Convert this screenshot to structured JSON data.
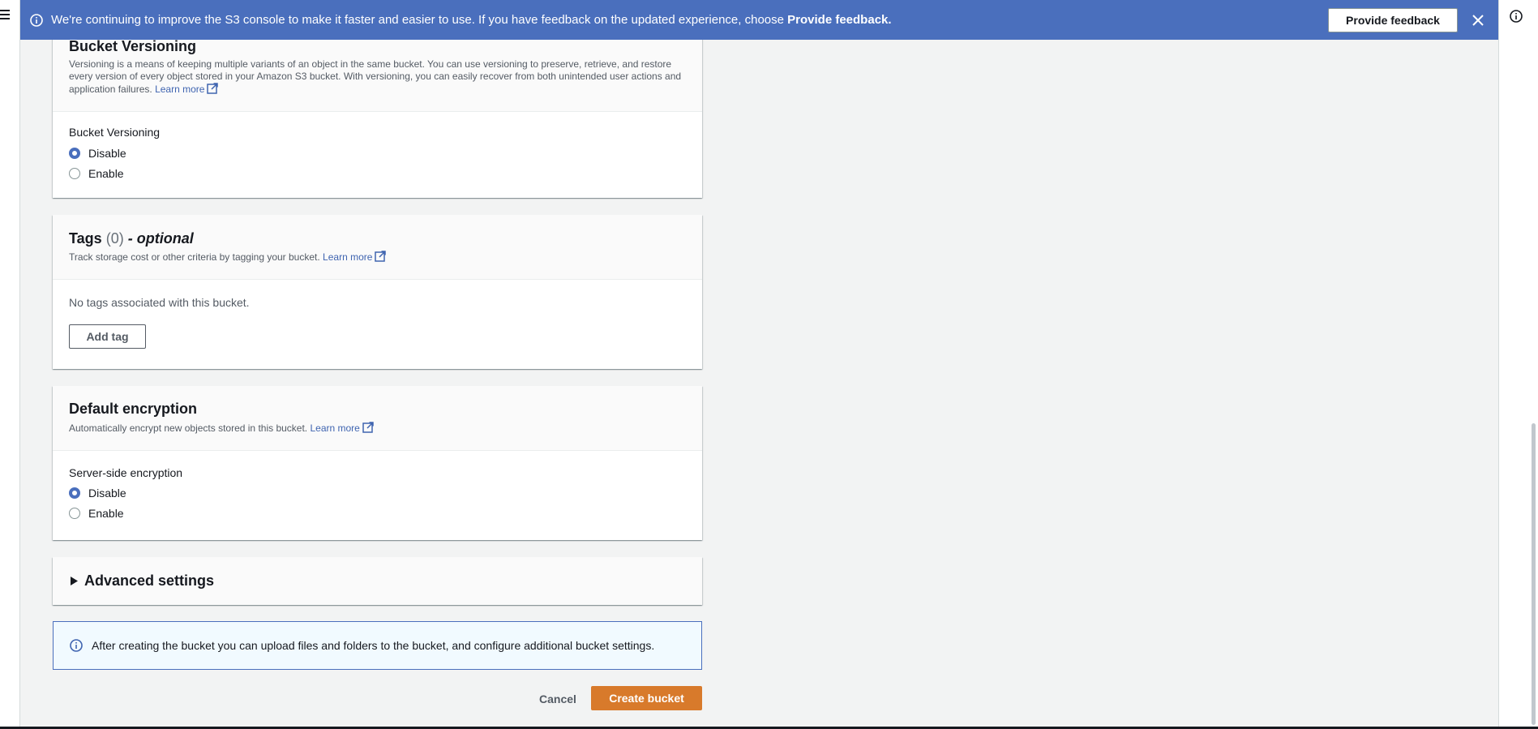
{
  "banner": {
    "text": "We're continuing to improve the S3 console to make it faster and easier to use. If you have feedback on the updated experience, choose ",
    "text_bold": "Provide feedback.",
    "button_label": "Provide feedback"
  },
  "versioning": {
    "title": "Bucket Versioning",
    "description": "Versioning is a means of keeping multiple variants of an object in the same bucket. You can use versioning to preserve, retrieve, and restore every version of every object stored in your Amazon S3 bucket. With versioning, you can easily recover from both unintended user actions and application failures.",
    "learn_more": "Learn more",
    "field_label": "Bucket Versioning",
    "options": [
      "Disable",
      "Enable"
    ],
    "selected": "Disable"
  },
  "tags": {
    "title": "Tags",
    "count": "(0)",
    "optional": "- optional",
    "description": "Track storage cost or other criteria by tagging your bucket.",
    "learn_more": "Learn more",
    "empty_text": "No tags associated with this bucket.",
    "add_button": "Add tag"
  },
  "encryption": {
    "title": "Default encryption",
    "description": "Automatically encrypt new objects stored in this bucket.",
    "learn_more": "Learn more",
    "field_label": "Server-side encryption",
    "options": [
      "Disable",
      "Enable"
    ],
    "selected": "Disable"
  },
  "advanced": {
    "title": "Advanced settings"
  },
  "info_box": {
    "text": "After creating the bucket you can upload files and folders to the bucket, and configure additional bucket settings."
  },
  "actions": {
    "cancel": "Cancel",
    "create": "Create bucket"
  },
  "colors": {
    "banner_bg": "#4a6fbd",
    "primary_button": "#d87a2b",
    "link": "#3f64b0",
    "page_bg": "#f2f3f3"
  },
  "icons": [
    "menu-icon",
    "info-icon",
    "close-icon",
    "external-link-icon",
    "caret-right-icon"
  ]
}
